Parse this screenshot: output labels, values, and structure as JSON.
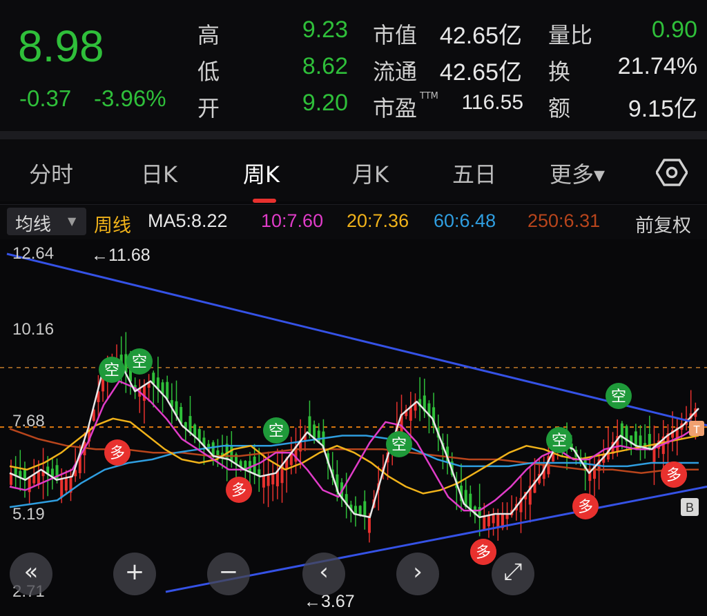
{
  "quote": {
    "price": "8.98",
    "change": "-0.37",
    "change_pct": "-3.96%",
    "high_label": "高",
    "high": "9.23",
    "low_label": "低",
    "low": "8.62",
    "open_label": "开",
    "open": "9.20",
    "mktcap_label": "市值",
    "mktcap": "42.65亿",
    "float_label": "流通",
    "float": "42.65亿",
    "pe_label": "市盈",
    "pe_sup": "TTM",
    "pe": "116.55",
    "volratio_label": "量比",
    "volratio": "0.90",
    "turnover_label": "换",
    "turnover": "21.74%",
    "amount_label": "额",
    "amount": "9.15亿"
  },
  "tabs": [
    "分时",
    "日K",
    "周K",
    "月K",
    "五日",
    "更多▾"
  ],
  "active_tab": "周K",
  "ma_bar": {
    "selector": "均线",
    "period": "周线",
    "ma5": "MA5:8.22",
    "ma10": "10:7.60",
    "ma20": "20:7.36",
    "ma60": "60:6.48",
    "ma250": "250:6.31",
    "adjust": "前复权"
  },
  "colors": {
    "up": "#e8312e",
    "down": "#2fbf3a",
    "ma5": "#e8e8e8",
    "ma10": "#e03cc8",
    "ma20": "#f0b21a",
    "ma60": "#2f9ee0",
    "ma250": "#b8451c",
    "trend": "#3552e6"
  },
  "chart_data": {
    "type": "candlestick",
    "y_ticks": [
      "12.64",
      "10.16",
      "7.68",
      "5.19",
      "2.71"
    ],
    "ylim": [
      2.71,
      12.64
    ],
    "annotations": {
      "max": "←11.68",
      "min": "←3.67"
    },
    "ma5_path": [
      6.2,
      6.0,
      6.3,
      6.0,
      6.1,
      7.5,
      9.3,
      9.5,
      8.6,
      8.9,
      8.4,
      7.6,
      7.2,
      6.7,
      6.6,
      6.3,
      6.1,
      6.2,
      6.8,
      7.4,
      7.0,
      5.6,
      5.0,
      4.9,
      6.5,
      7.9,
      8.3,
      7.8,
      6.6,
      5.3,
      4.9,
      5.0,
      5.0,
      5.6,
      6.2,
      7.1,
      6.9,
      6.2,
      6.7,
      7.3,
      7.0,
      6.9,
      7.3,
      7.6,
      8.1
    ],
    "ma10_path": [
      5.8,
      5.7,
      5.9,
      6.1,
      6.3,
      7.1,
      8.2,
      8.9,
      8.7,
      8.3,
      7.8,
      7.2,
      6.9,
      6.6,
      6.3,
      6.3,
      6.5,
      6.8,
      6.8,
      6.3,
      5.7,
      5.5,
      6.3,
      7.1,
      7.7,
      7.6,
      7.1,
      6.3,
      5.5,
      5.1,
      5.1,
      5.4,
      5.8,
      6.3,
      6.7,
      6.9,
      6.6,
      6.6,
      6.9,
      7.0,
      6.9,
      6.9,
      7.1,
      7.3,
      7.6
    ],
    "ma20_path": [
      6.4,
      6.3,
      6.5,
      6.8,
      7.2,
      7.6,
      7.8,
      7.7,
      7.3,
      6.9,
      6.6,
      6.5,
      6.6,
      6.9,
      7.0,
      6.6,
      6.3,
      6.5,
      6.8,
      7.0,
      6.8,
      6.5,
      6.1,
      5.8,
      5.6,
      5.7,
      5.9,
      6.2,
      6.5,
      6.8,
      7.0,
      6.9,
      6.7,
      6.6,
      6.7,
      6.8,
      6.9,
      7.0,
      7.1,
      7.2,
      7.3
    ],
    "ma60_path": [
      5.2,
      5.3,
      5.4,
      5.9,
      6.3,
      6.5,
      6.6,
      6.8,
      6.9,
      7.0,
      7.0,
      7.0,
      7.1,
      7.2,
      7.3,
      7.3,
      7.2,
      6.9,
      6.6,
      6.4,
      6.4,
      6.4,
      6.5,
      6.5,
      6.5,
      6.4,
      6.4,
      6.5,
      6.5,
      6.5
    ],
    "ma250_path": [
      7.5,
      7.2,
      7.0,
      6.9,
      6.9,
      6.8,
      6.8,
      6.7,
      6.7,
      6.8,
      6.9,
      6.9,
      6.9,
      6.9,
      6.8,
      6.7,
      6.6,
      6.6,
      6.5,
      6.4,
      6.3,
      6.3,
      6.2,
      6.3,
      6.3
    ],
    "signals": [
      {
        "text": "空",
        "type": "short"
      },
      {
        "text": "空",
        "type": "short"
      },
      {
        "text": "多",
        "type": "long"
      },
      {
        "text": "多",
        "type": "long"
      },
      {
        "text": "空",
        "type": "short"
      },
      {
        "text": "空",
        "type": "short"
      },
      {
        "text": "空",
        "type": "short"
      },
      {
        "text": "多",
        "type": "long"
      },
      {
        "text": "多",
        "type": "long"
      },
      {
        "text": "多",
        "type": "long"
      },
      {
        "text": "空",
        "type": "short"
      },
      {
        "text": "多",
        "type": "long"
      },
      {
        "text": "多",
        "type": "long"
      }
    ],
    "b_marker": "B",
    "t_marker": "T"
  },
  "controls": [
    "«",
    "+",
    "−",
    "‹",
    "›",
    "⤢"
  ]
}
